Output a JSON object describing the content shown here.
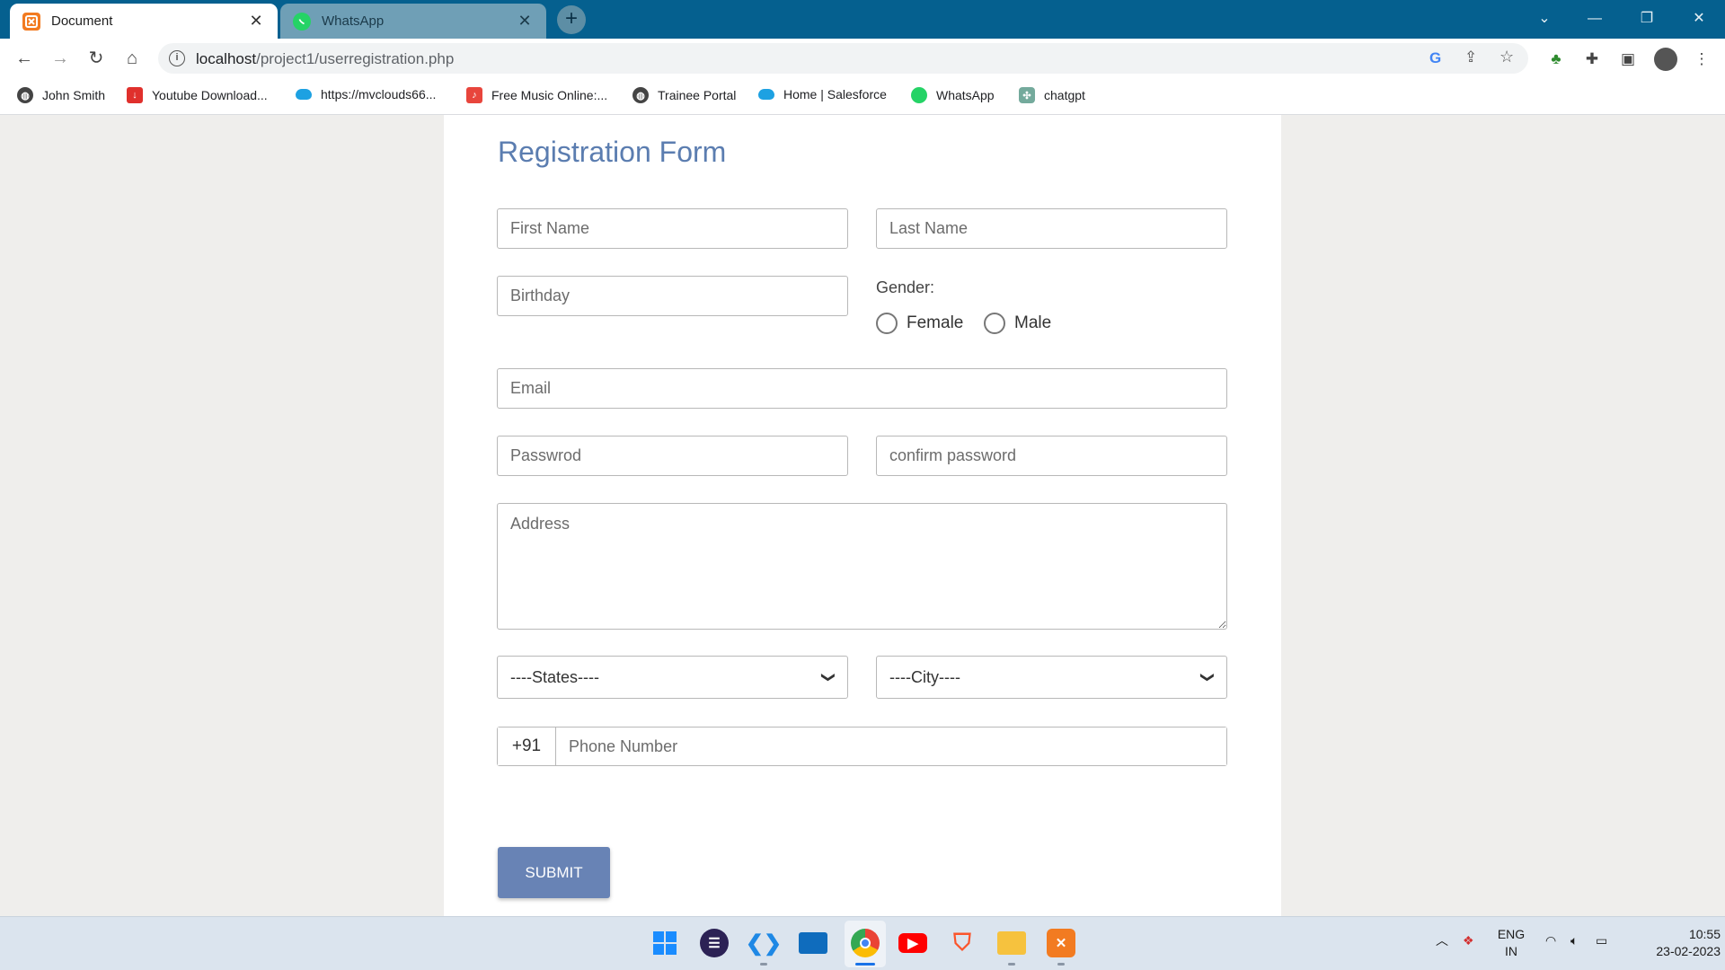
{
  "browser": {
    "tabs": [
      {
        "title": "Document",
        "icon": "xampp-icon"
      },
      {
        "title": "WhatsApp",
        "icon": "whatsapp-icon"
      }
    ],
    "url_host": "localhost",
    "url_path": "/project1/userregistration.php",
    "bookmarks": [
      {
        "label": "John Smith",
        "icon": "globe-icon"
      },
      {
        "label": "Youtube Download...",
        "icon": "download-icon"
      },
      {
        "label": "https://mvclouds66...",
        "icon": "cloud-icon"
      },
      {
        "label": "Free Music Online:...",
        "icon": "music-icon"
      },
      {
        "label": "Trainee Portal",
        "icon": "globe-icon"
      },
      {
        "label": "Home | Salesforce",
        "icon": "cloud-icon"
      },
      {
        "label": "WhatsApp",
        "icon": "whatsapp-icon"
      },
      {
        "label": "chatgpt",
        "icon": "chatgpt-icon"
      }
    ]
  },
  "form": {
    "title": "Registration Form",
    "first_name_placeholder": "First Name",
    "last_name_placeholder": "Last Name",
    "birthday_placeholder": "Birthday",
    "gender_label": "Gender:",
    "gender_options": [
      "Female",
      "Male"
    ],
    "email_placeholder": "Email",
    "password_placeholder": "Passwrod",
    "confirm_password_placeholder": "confirm password",
    "address_placeholder": "Address",
    "states_selected": "----States----",
    "city_selected": "----City----",
    "phone_prefix": "+91",
    "phone_placeholder": "Phone Number",
    "submit_label": "SUBMIT"
  },
  "taskbar": {
    "language": "ENG",
    "region": "IN",
    "time": "10:55",
    "date": "23-02-2023"
  },
  "colors": {
    "titlebar": "#05608f",
    "form_title": "#5b7db0",
    "submit_button": "#6883b5"
  }
}
